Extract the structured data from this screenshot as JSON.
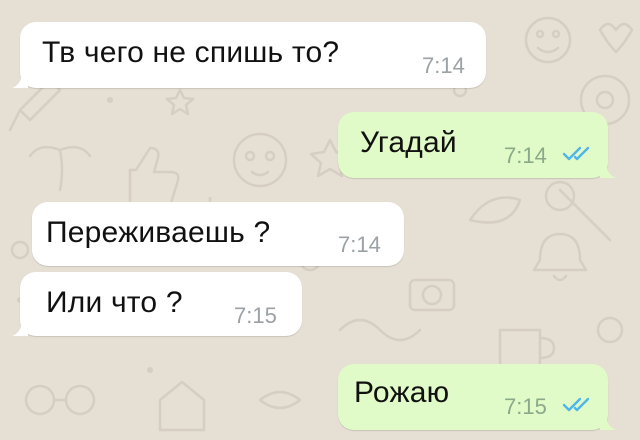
{
  "colors": {
    "wallpaper": "#e6dfd4",
    "incoming_bubble": "#ffffff",
    "outgoing_bubble": "#e1fbc8",
    "read_ticks": "#4fb6ec",
    "time_text": "#9aa2a6"
  },
  "messages": [
    {
      "direction": "incoming",
      "text": "Тв чего не спишь то?",
      "time": "7:14"
    },
    {
      "direction": "outgoing",
      "text": "Угадай",
      "time": "7:14",
      "status_icon": "double-check-read-icon"
    },
    {
      "direction": "incoming",
      "text": "Переживаешь ?",
      "time": "7:14"
    },
    {
      "direction": "incoming",
      "text": "Или что ?",
      "time": "7:15"
    },
    {
      "direction": "outgoing",
      "text": "Рожаю",
      "time": "7:15",
      "status_icon": "double-check-read-icon"
    }
  ]
}
